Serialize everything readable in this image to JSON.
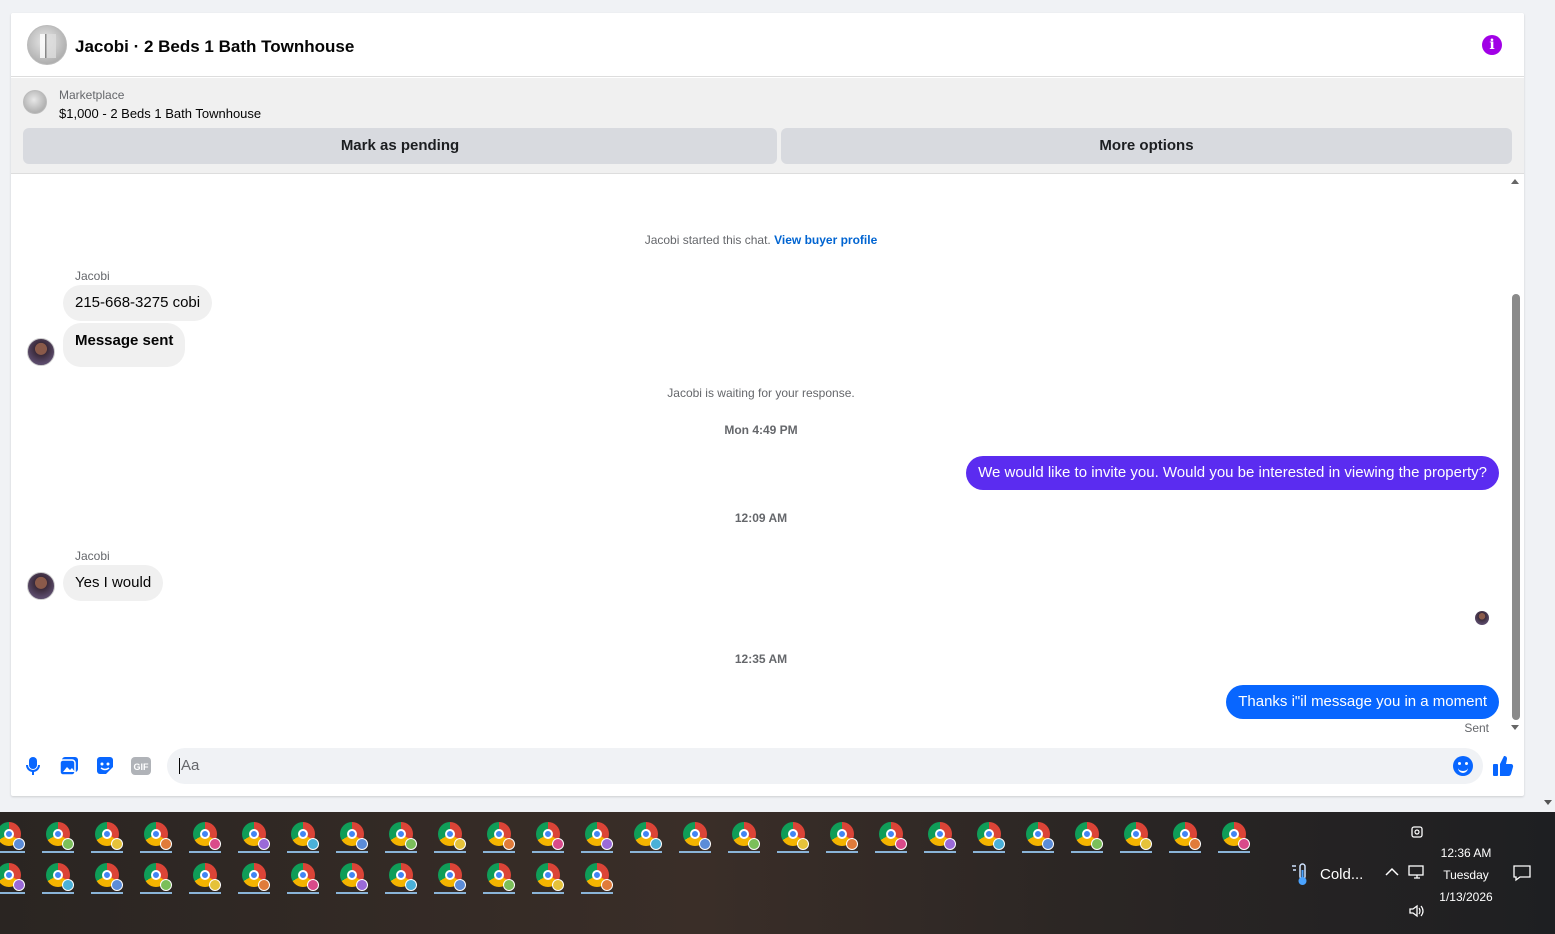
{
  "header": {
    "title": "Jacobi · 2 Beds 1 Bath Townhouse",
    "info_icon": "info-icon"
  },
  "listing": {
    "category": "Marketplace",
    "name": "$1,000 - 2 Beds 1 Bath Townhouse",
    "pending_label": "Mark as pending",
    "more_label": "More options"
  },
  "chat": {
    "started_text": "Jacobi started this chat.",
    "view_profile_label": "View buyer profile",
    "waiting_text": "Jacobi is waiting for your response.",
    "messages": [
      {
        "sender": "Jacobi",
        "text": "215-668-3275 cobi",
        "direction": "in"
      },
      {
        "text": "Message sent",
        "direction": "in"
      },
      {
        "timestamp": "Mon 4:49 PM"
      },
      {
        "text": "We would like to invite you. Would you be interested in viewing the property?",
        "direction": "out",
        "color": "#5b2cf0"
      },
      {
        "timestamp": "12:09 AM"
      },
      {
        "sender": "Jacobi",
        "text": "Yes I would",
        "direction": "in"
      },
      {
        "timestamp": "12:35 AM"
      },
      {
        "text": "Thanks i\"il message you in a moment",
        "direction": "out",
        "color": "#0866ff"
      }
    ],
    "status": "Sent"
  },
  "composer": {
    "placeholder": "Aa",
    "icons": [
      "microphone-icon",
      "photo-icon",
      "sticker-icon",
      "gif-icon",
      "emoji-icon",
      "thumbs-up-icon"
    ],
    "gif_label": "GIF"
  },
  "taskbar": {
    "weather": "Cold...",
    "time": "12:36 AM",
    "day": "Tuesday",
    "date": "1/13/2026",
    "badge_colors": [
      "#5b8cd8",
      "#7bbf5a",
      "#e5c23a",
      "#e07b3a",
      "#d94a8a",
      "#9a6ad8",
      "#4ab0d8"
    ]
  },
  "colors": {
    "accent": "#0866ff",
    "violet_bubble": "#5b2cf0",
    "info": "#a100e6"
  }
}
